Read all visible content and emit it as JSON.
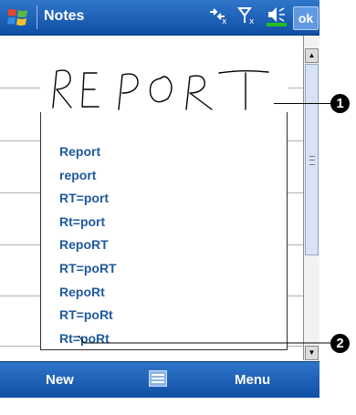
{
  "titlebar": {
    "title": "Notes",
    "ok_label": "ok"
  },
  "icons": {
    "start": "windows-start-icon",
    "connectivity": "connectivity-icon",
    "signal": "signal-icon",
    "volume": "volume-icon"
  },
  "handwriting": {
    "ink_text": "REPORT"
  },
  "suggestions": [
    "Report",
    "report",
    "RT=port",
    "Rt=port",
    "RepoRT",
    "RT=poRT",
    "RepoRt",
    "RT=poRt",
    "Rt=poRt"
  ],
  "callouts": [
    "1",
    "2"
  ],
  "menubar": {
    "left_label": "New",
    "right_label": "Menu"
  },
  "colors": {
    "titlebar": "#1f5fb8",
    "suggestion_text": "#1f5aa0",
    "battery": "#22c022"
  }
}
